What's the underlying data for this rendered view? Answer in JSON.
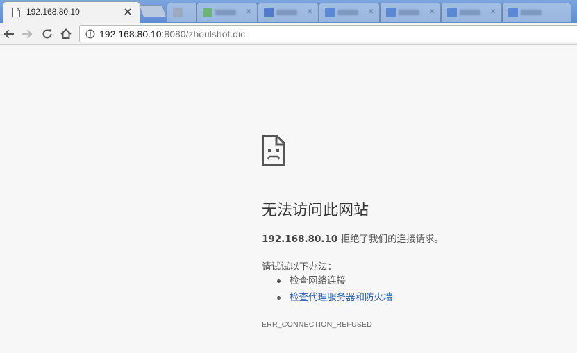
{
  "tabs": {
    "active": {
      "title": "192.168.80.10"
    }
  },
  "omnibox": {
    "url_host": "192.168.80.10",
    "url_rest": ":8080/zhoulshot.dic"
  },
  "error_page": {
    "title": "无法访问此网站",
    "host": "192.168.80.10",
    "description": " 拒绝了我们的连接请求。",
    "try_label": "请试试以下办法：",
    "suggestions": [
      {
        "label": "检查网络连接"
      },
      {
        "label": "检查代理服务器和防火墙"
      }
    ],
    "error_code": "ERR_CONNECTION_REFUSED"
  },
  "colors": {
    "tabstrip": "#6f9bd8",
    "page_background": "#f7f7f7",
    "link": "#2a5db0"
  }
}
